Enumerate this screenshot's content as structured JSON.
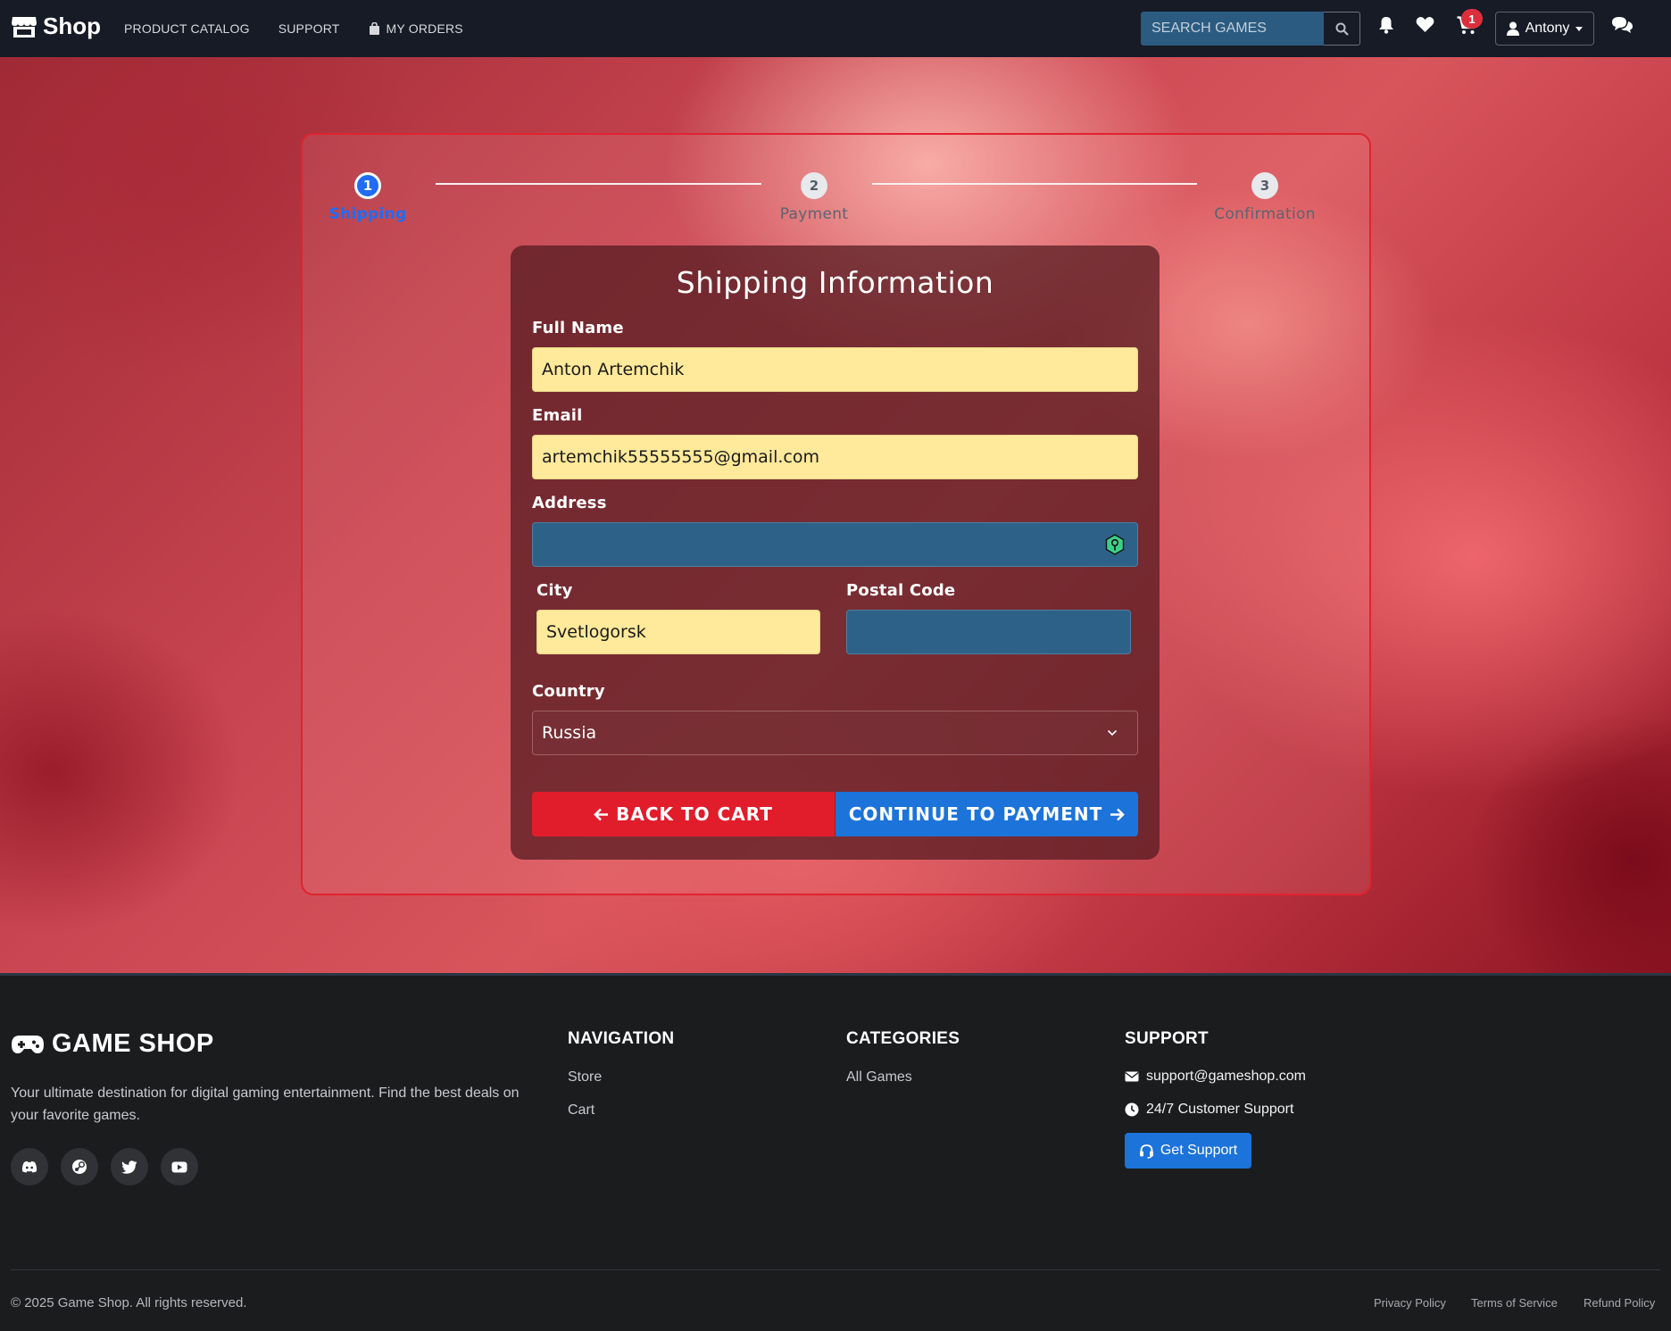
{
  "navbar": {
    "brand": "Shop",
    "links": [
      "PRODUCT CATALOG",
      "SUPPORT",
      "MY ORDERS"
    ],
    "search_placeholder": "SEARCH GAMES",
    "cart_count": "1",
    "user_name": "Antony"
  },
  "stepper": {
    "steps": [
      {
        "number": "1",
        "label": "Shipping",
        "state": "active"
      },
      {
        "number": "2",
        "label": "Payment",
        "state": "inactive"
      },
      {
        "number": "3",
        "label": "Confirmation",
        "state": "inactive"
      }
    ]
  },
  "form": {
    "title": "Shipping Information",
    "full_name_label": "Full Name",
    "full_name_value": "Anton Artemchik",
    "email_label": "Email",
    "email_value": "artemchik55555555@gmail.com",
    "address_label": "Address",
    "address_value": "",
    "city_label": "City",
    "city_value": "Svetlogorsk",
    "postal_label": "Postal Code",
    "postal_value": "",
    "country_label": "Country",
    "country_value": "Russia",
    "back_label": "BACK TO CART",
    "continue_label": "CONTINUE TO PAYMENT"
  },
  "footer": {
    "brand": "GAME SHOP",
    "description": "Your ultimate destination for digital gaming entertainment. Find the best deals on your favorite games.",
    "social_icons": [
      "discord-icon",
      "steam-icon",
      "twitter-icon",
      "youtube-icon"
    ],
    "navigation_heading": "NAVIGATION",
    "navigation_links": [
      "Store",
      "Cart"
    ],
    "categories_heading": "CATEGORIES",
    "categories_links": [
      "All Games"
    ],
    "support_heading": "SUPPORT",
    "support_email": "support@gameshop.com",
    "support_hours": "24/7 Customer Support",
    "support_button": "Get Support",
    "copyright": "© 2025 Game Shop. All rights reserved.",
    "legal_links": [
      "Privacy Policy",
      "Terms of Service",
      "Refund Policy"
    ]
  },
  "colors": {
    "navbar_bg": "#161b26",
    "accent_blue": "#1c73d9",
    "accent_red": "#e11d2b",
    "filled_input_bg": "#ffe99a",
    "empty_input_bg": "#2e6187"
  }
}
